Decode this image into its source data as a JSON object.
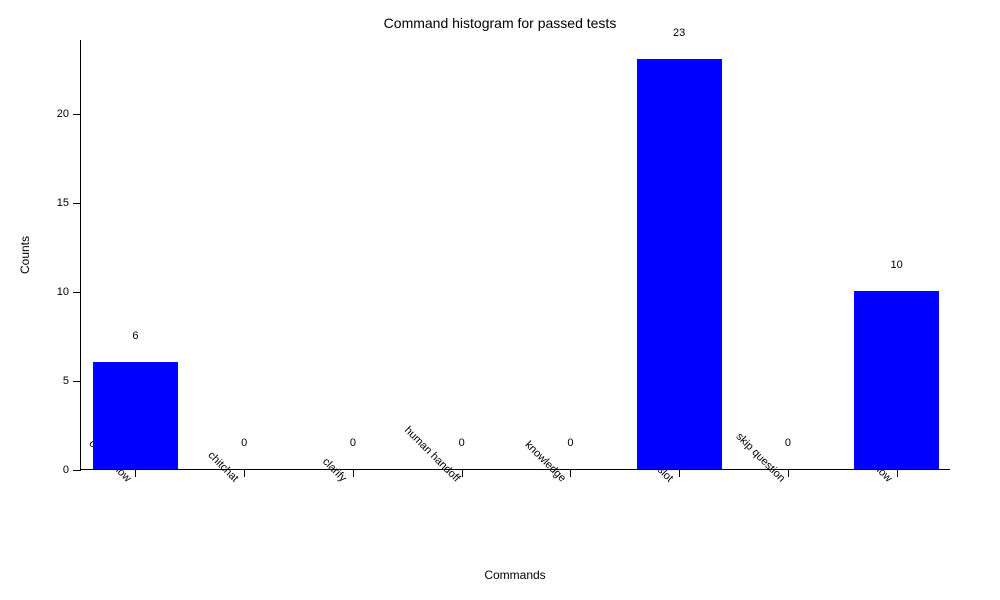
{
  "chart_data": {
    "type": "bar",
    "title": "Command histogram for passed tests",
    "xlabel": "Commands",
    "ylabel": "Counts",
    "categories": [
      "cancel flow",
      "chitchat",
      "clarify",
      "human handoff",
      "knowledge",
      "set slot",
      "skip question",
      "start flow"
    ],
    "values": [
      6,
      0,
      0,
      0,
      0,
      23,
      0,
      10
    ],
    "ylim": [
      0,
      24.15
    ],
    "yticks": [
      0,
      5,
      10,
      15,
      20
    ],
    "bar_color": "#0000FF"
  }
}
